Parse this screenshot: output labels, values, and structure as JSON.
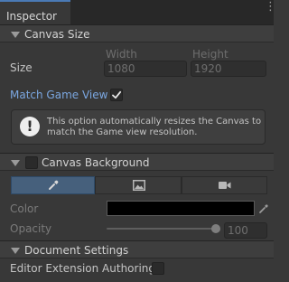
{
  "window": {
    "tab_title": "Inspector"
  },
  "sections": {
    "canvas_size": {
      "title": "Canvas Size",
      "size_label": "Size",
      "width_label": "Width",
      "height_label": "Height",
      "width_value": "1080",
      "height_value": "1920",
      "match_game_view_label": "Match Game View",
      "match_game_view_checked": true,
      "help_text": "This option automatically resizes the Canvas to match the Game view resolution."
    },
    "canvas_background": {
      "title": "Canvas Background",
      "enabled": false,
      "modes": [
        {
          "name": "eyedropper-icon",
          "active": true
        },
        {
          "name": "image-icon",
          "active": false
        },
        {
          "name": "camera-icon",
          "active": false
        }
      ],
      "color_label": "Color",
      "color_value": "#000000",
      "opacity_label": "Opacity",
      "opacity_value": "100"
    },
    "document_settings": {
      "title": "Document Settings",
      "editor_extension_label": "Editor Extension Authoring",
      "editor_extension_checked": false
    }
  },
  "colors": {
    "panel_bg": "#383838",
    "accent_blue": "#4a7ab5",
    "link_blue": "#7ba7e1"
  }
}
